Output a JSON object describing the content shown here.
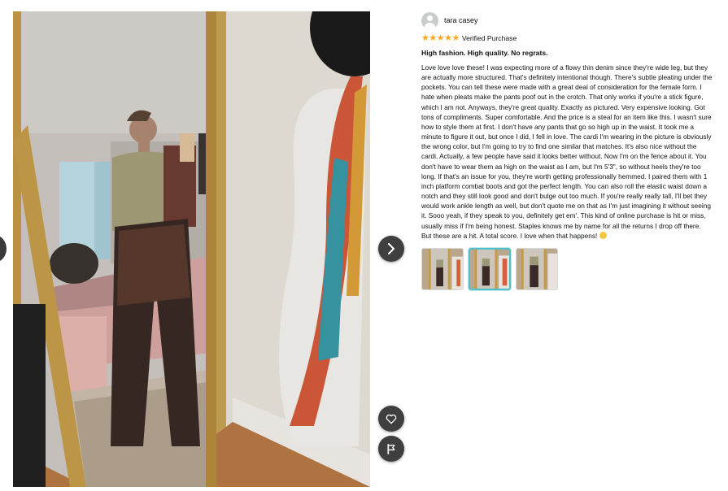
{
  "viewer": {
    "prev_icon": "chevron-left-icon",
    "next_icon": "chevron-right-icon",
    "like_icon": "heart-icon",
    "report_icon": "flag-icon"
  },
  "review": {
    "reviewer_name": "tara casey",
    "rating": 5,
    "rating_max": 5,
    "badge": "Verified Purchase",
    "title": "High fashion. High quality. No regrats.",
    "body": "Love love love these! I was expecting more of a flowy thin denim since they're wide leg, but they are actually more structured. That's definitely intentional though. There's subtle pleating under the pockets. You can tell these were made with a great deal of consideration for the female form. I hate when pleats make the pants poof out in the crotch. That only works if you're a stick figure, which I am not. Anyways, they're great quality. Exactly as pictured. Very expensive looking. Got tons of compliments. Super comfortable. And the price is a steal for an item like this. I wasn't sure how to style them at first. I don't have any pants that go so high up in the waist. It took me a minute to figure it out, but once I did, I fell in love. The cardi I'm wearing in the picture is obviously the wrong color, but I'm going to try to find one similar that matches. It's also nice without the cardi. Actually, a few people have said it looks better without. Now I'm on the fence about it. You don't have to wear them as high on the waist as I am, but I'm 5'3\", so without heels they're too long. If that's an issue for you, they're worth getting professionally hemmed. I paired them with 1 inch platform combat boots and got the perfect length. You can also roll the elastic waist down a notch and they still look good and don't bulge out too much. If you're really really tall, I'll bet they would work ankle length as well, but don't quote me on that as I'm just imagining it without seeing it. Sooo yeah, if they speak to you, definitely get em'. This kind of online purchase is hit or miss, usually miss if I'm being honest. Staples knows me by name for all the returns I drop off there. But these are a hit. A total score. I love when that happens!",
    "emoji_icon": "grinning-face-icon",
    "thumbnails_selected": 2,
    "thumbnail_count": 3
  },
  "colors": {
    "star": "#ffa41c",
    "selected_border": "#4fc0c9",
    "button_bg": "#3f3f3f"
  }
}
